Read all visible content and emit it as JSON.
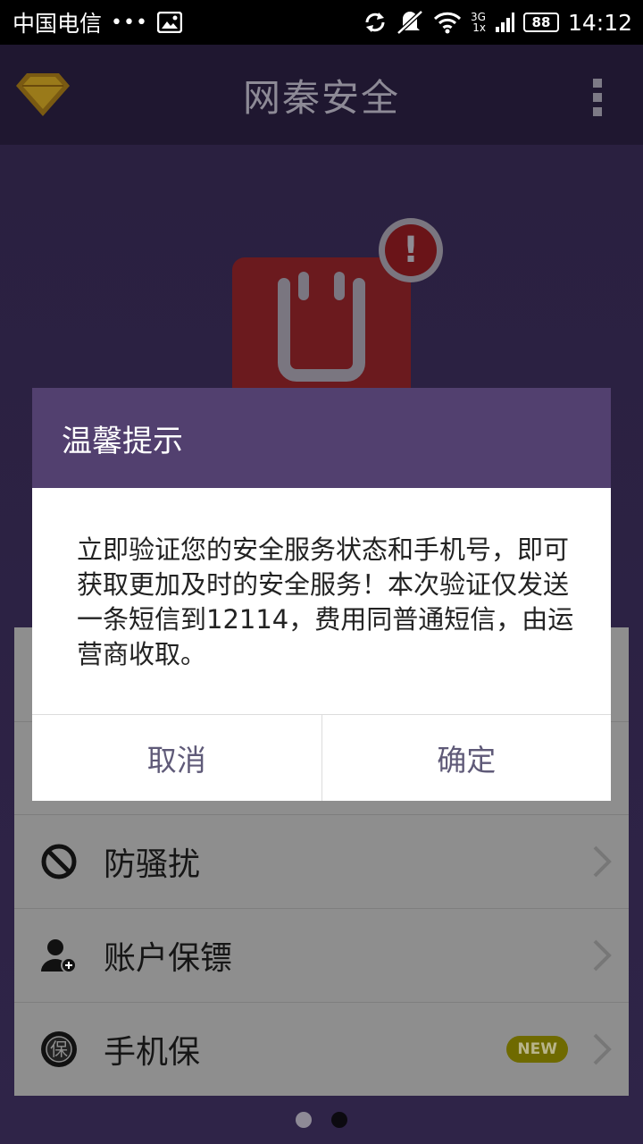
{
  "status_bar": {
    "carrier": "中国电信",
    "dots": "•••",
    "network_top": "3G",
    "network_bottom": "1x",
    "battery": "88",
    "time": "14:12"
  },
  "app": {
    "title": "网秦安全"
  },
  "list": {
    "items": [
      {
        "label": "防骚扰",
        "icon": "block-icon"
      },
      {
        "label": "账户保镖",
        "icon": "user-shield-icon"
      },
      {
        "label": "手机保",
        "icon": "protect-badge-icon",
        "badge": "NEW",
        "icon_text": "保"
      }
    ]
  },
  "hero": {
    "alert_mark": "!"
  },
  "dialog": {
    "title": "温馨提示",
    "message": "立即验证您的安全服务状态和手机号，即可获取更加及时的安全服务！本次验证仅发送一条短信到12114，费用同普通短信，由运营商收取。",
    "cancel_label": "取消",
    "confirm_label": "确定"
  },
  "colors": {
    "dialog_header": "#52406f",
    "button_text": "#5f5a78",
    "app_background": "#2f2448"
  }
}
